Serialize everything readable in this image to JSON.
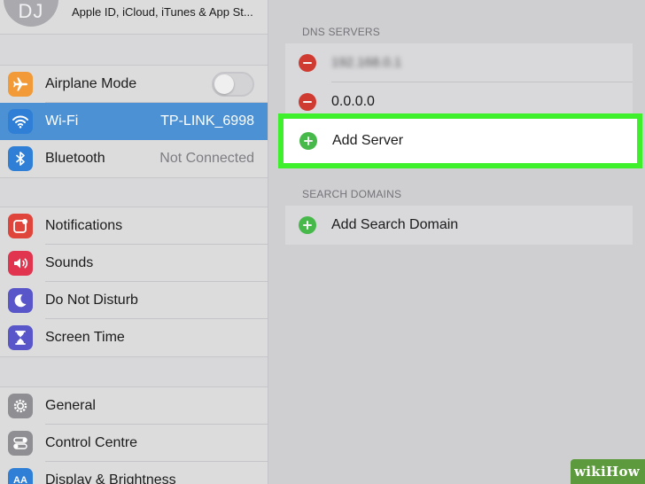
{
  "profile": {
    "initials": "DJ",
    "subtitle": "Apple ID, iCloud, iTunes & App St..."
  },
  "sidebar": {
    "group1": [
      {
        "label": "Airplane Mode",
        "icon": "airplane-icon",
        "icon_color": "#f19a37",
        "control": "toggle",
        "toggle_on": false
      },
      {
        "label": "Wi-Fi",
        "icon": "wifi-icon",
        "icon_color": "#2f7fd6",
        "value": "TP-LINK_6998",
        "selected": true
      },
      {
        "label": "Bluetooth",
        "icon": "bluetooth-icon",
        "icon_color": "#2f7fd6",
        "value": "Not Connected"
      }
    ],
    "group2": [
      {
        "label": "Notifications",
        "icon": "notifications-icon",
        "icon_color": "#e0453b"
      },
      {
        "label": "Sounds",
        "icon": "sounds-icon",
        "icon_color": "#e0344f"
      },
      {
        "label": "Do Not Disturb",
        "icon": "moon-icon",
        "icon_color": "#5856c8"
      },
      {
        "label": "Screen Time",
        "icon": "hourglass-icon",
        "icon_color": "#5856c8"
      }
    ],
    "group3": [
      {
        "label": "General",
        "icon": "gear-icon",
        "icon_color": "#8e8e93"
      },
      {
        "label": "Control Centre",
        "icon": "control-centre-icon",
        "icon_color": "#8e8e93"
      },
      {
        "label": "Display & Brightness",
        "icon": "display-icon",
        "icon_color": "#2f7fd6",
        "icon_text": "AA"
      }
    ]
  },
  "detail": {
    "dns_header": "DNS SERVERS",
    "dns_servers": [
      {
        "value": "192.168.0.1",
        "blurred": true
      },
      {
        "value": "0.0.0.0",
        "blurred": false
      }
    ],
    "add_server_label": "Add Server",
    "search_header": "SEARCH DOMAINS",
    "add_search_domain_label": "Add Search Domain"
  },
  "colors": {
    "selection": "#4c91d3",
    "highlight": "#3ef02c",
    "remove": "#cf3b31",
    "add": "#47b84a",
    "watermark_bg": "#5d9a3e"
  },
  "watermark": {
    "text": "wikiHow"
  }
}
